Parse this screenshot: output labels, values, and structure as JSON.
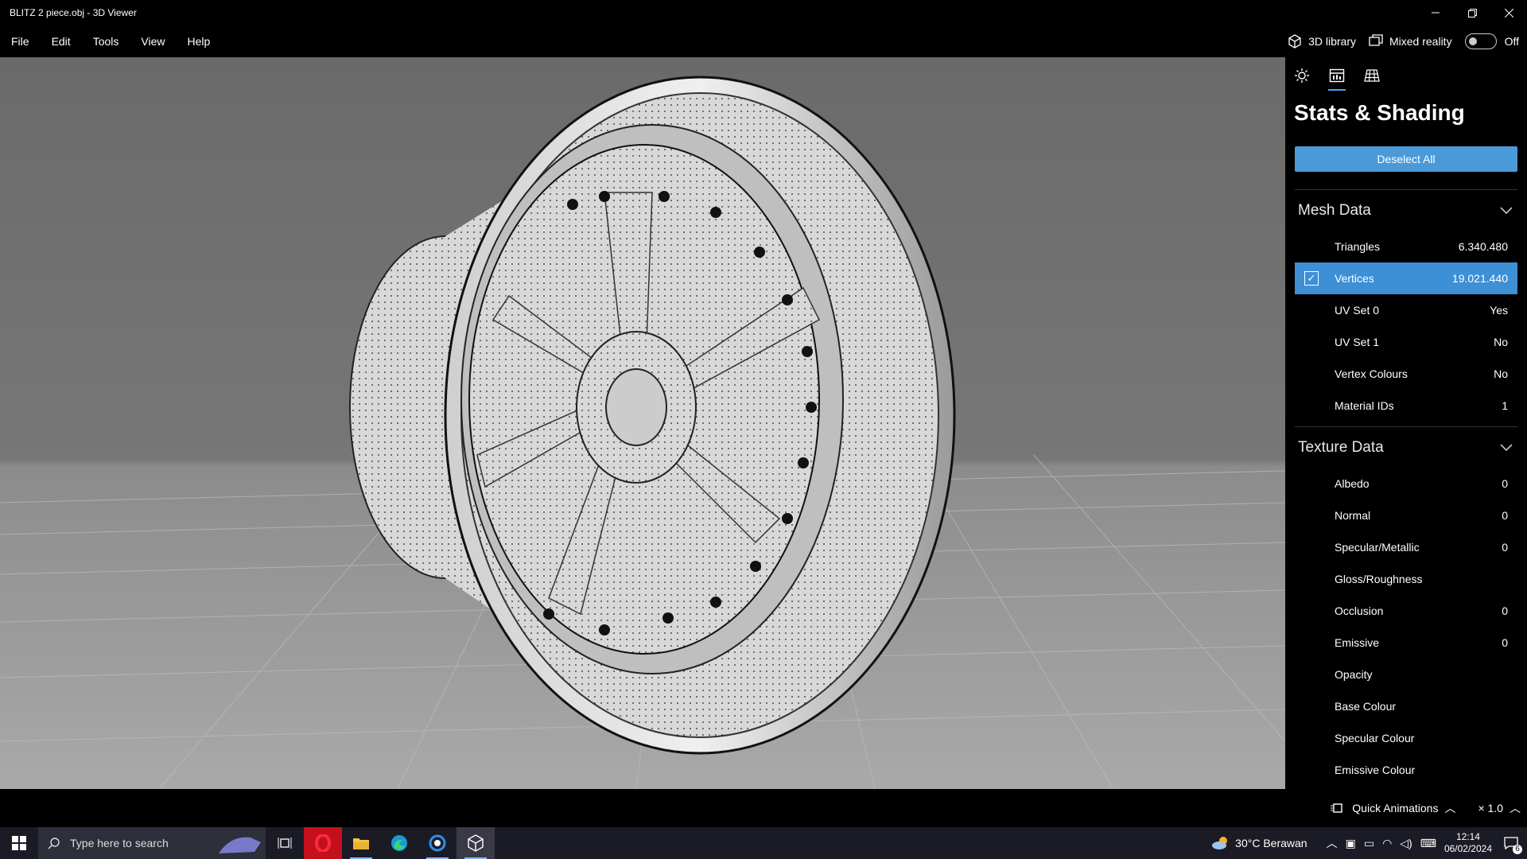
{
  "window": {
    "title": "BLITZ 2 piece.obj - 3D Viewer"
  },
  "menu": {
    "items": [
      "File",
      "Edit",
      "Tools",
      "View",
      "Help"
    ]
  },
  "toolbar": {
    "library_label": "3D library",
    "mixed_reality_label": "Mixed reality",
    "mixed_reality_state": "Off"
  },
  "panel": {
    "title": "Stats & Shading",
    "deselect_label": "Deselect All",
    "mesh": {
      "title": "Mesh Data",
      "rows": [
        {
          "label": "Triangles",
          "value": "6.340.480"
        },
        {
          "label": "Vertices",
          "value": "19.021.440",
          "selected": true
        },
        {
          "label": "UV Set 0",
          "value": "Yes"
        },
        {
          "label": "UV Set 1",
          "value": "No"
        },
        {
          "label": "Vertex Colours",
          "value": "No"
        },
        {
          "label": "Material IDs",
          "value": "1"
        }
      ]
    },
    "texture": {
      "title": "Texture Data",
      "rows": [
        {
          "label": "Albedo",
          "value": "0"
        },
        {
          "label": "Normal",
          "value": "0"
        },
        {
          "label": "Specular/Metallic",
          "value": "0"
        },
        {
          "label": "Gloss/Roughness",
          "value": ""
        },
        {
          "label": "Occlusion",
          "value": "0"
        },
        {
          "label": "Emissive",
          "value": "0"
        },
        {
          "label": "Opacity",
          "value": ""
        },
        {
          "label": "Base Colour",
          "value": ""
        },
        {
          "label": "Specular Colour",
          "value": ""
        },
        {
          "label": "Emissive Colour",
          "value": ""
        }
      ]
    }
  },
  "statusbar": {
    "quick_animations": "Quick Animations",
    "speed": "× 1.0"
  },
  "taskbar": {
    "search_placeholder": "Type here to search",
    "weather": "30°C  Berawan",
    "time": "12:14",
    "date": "06/02/2024",
    "notifications": "6"
  },
  "colors": {
    "accent": "#4a9ad9",
    "selected_row": "#3d8fd6",
    "background": "#000000"
  }
}
